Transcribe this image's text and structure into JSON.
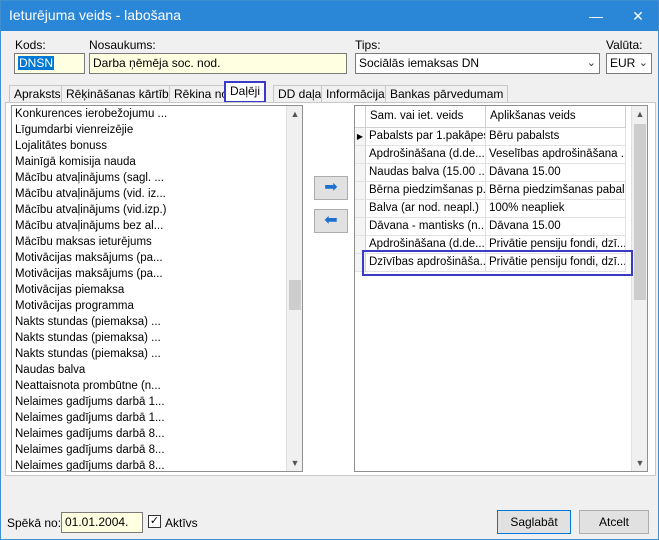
{
  "window": {
    "title": "Ieturējuma veids - labošana",
    "minimize_glyph": "—",
    "close_glyph": "✕"
  },
  "form": {
    "kods_label": "Kods:",
    "kods_value": "DNSN",
    "nosaukums_label": "Nosaukums:",
    "nosaukums_value": "Darba ņēmēja soc. nod.",
    "tips_label": "Tips:",
    "tips_value": "Sociālās iemaksas DN",
    "valuta_label": "Valūta:",
    "valuta_value": "EUR"
  },
  "tabs": [
    {
      "label": "Apraksts"
    },
    {
      "label": "Rēķināšanas kārtība"
    },
    {
      "label": "Rēkina no"
    },
    {
      "label": "Daļēji"
    },
    {
      "label": "DD daļa"
    },
    {
      "label": "Informācija"
    },
    {
      "label": "Bankas pārvedumam"
    }
  ],
  "left_list": [
    "Konkurences ierobežojumu ...",
    "Līgumdarbi vienreizējie",
    "Lojalitātes bonuss",
    "Mainīgā komisija nauda",
    "Mācību atvaļinājums (sagl. ...",
    "Mācību atvaļinājums (vid. iz...",
    "Mācību atvaļinājums (vid.izp.)",
    "Mācību atvaļinājums bez al...",
    "Mācību maksas ieturējums",
    "Motivācijas maksājums (pa...",
    "Motivācijas maksājums (pa...",
    "Motivācijas piemaksa",
    "Motivācijas programma",
    "Nakts stundas (piemaksa) ...",
    "Nakts stundas (piemaksa) ...",
    "Nakts stundas (piemaksa) ...",
    "Naudas balva",
    "Neattaisnota prombūtne (n...",
    "Nelaimes gadījums darbā 1...",
    "Nelaimes gadījums darbā 1...",
    "Nelaimes gadījums darbā 8...",
    "Nelaimes gadījums darbā 8...",
    "Nelaimes gadījums darbā 8..."
  ],
  "move_buttons": {
    "right": "➡",
    "left": "⬅"
  },
  "grid": {
    "headers": [
      "Sam. vai iet. veids",
      "Aplikšanas veids"
    ],
    "rows": [
      {
        "col1": "Pabalsts par 1.pakāpes",
        "col2": "Bēru pabalsts"
      },
      {
        "col1": "Apdrošināšana (d.de...",
        "col2": "Veselības apdrošināšana ..."
      },
      {
        "col1": "Naudas balva (15.00 ...",
        "col2": "Dāvana 15.00"
      },
      {
        "col1": "Bērna piedzimšanas p...",
        "col2": "Bērna piedzimšanas pabal..."
      },
      {
        "col1": "Balva (ar nod. neapl.)",
        "col2": "100% neapliek"
      },
      {
        "col1": "Dāvana - mantisks (n...",
        "col2": "Dāvana 15.00"
      },
      {
        "col1": "Apdrošināšana (d.de...",
        "col2": "Privātie pensiju fondi, dzī..."
      },
      {
        "col1": "Dzīvības apdrošināša...",
        "col2": "Privātie pensiju fondi, dzī..."
      }
    ]
  },
  "bottom": {
    "speka_label": "Spēkā no:",
    "speka_value": "01.01.2004.",
    "aktivs_label": "Aktīvs",
    "aktivs_check": "✓",
    "save_label": "Saglabāt",
    "cancel_label": "Atcelt"
  }
}
